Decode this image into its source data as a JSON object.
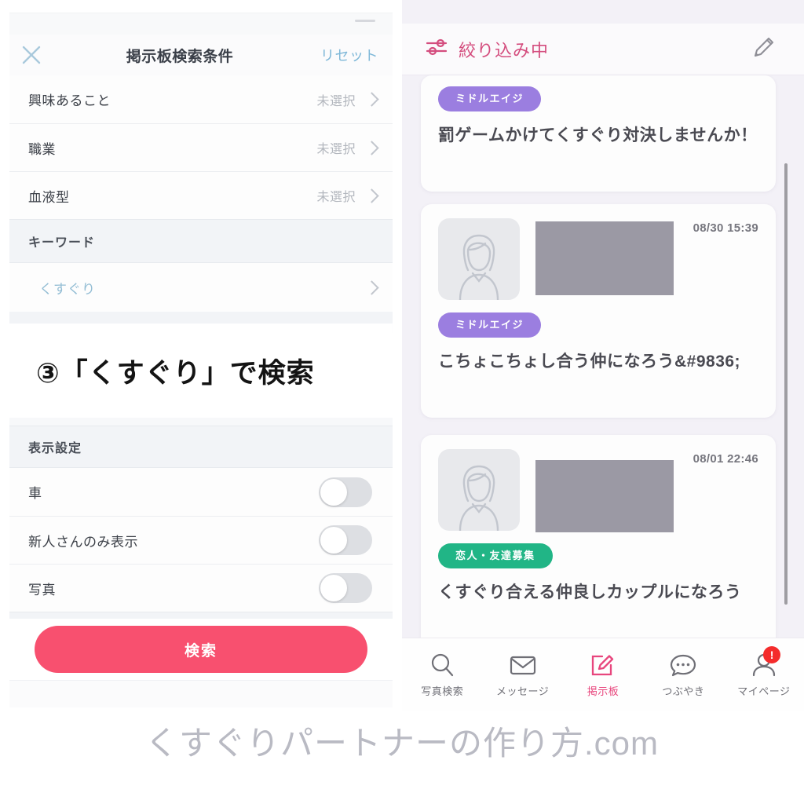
{
  "left_panel": {
    "header": {
      "close_icon": "close-x-icon",
      "title": "掲示板検索条件",
      "reset_label": "リセット"
    },
    "filter_rows": [
      {
        "label": "興味あること",
        "value": "未選択",
        "chevron": "chevron-right-icon"
      },
      {
        "label": "職業",
        "value": "未選択",
        "chevron": "chevron-right-icon"
      },
      {
        "label": "血液型",
        "value": "未選択",
        "chevron": "chevron-right-icon"
      }
    ],
    "keyword_section": {
      "section_label": "キーワード",
      "keyword_value": "くすぐり",
      "chevron": "chevron-right-icon"
    },
    "display_section": {
      "section_label": "表示設定",
      "toggles": [
        {
          "label": "車",
          "on": false
        },
        {
          "label": "新人さんのみ表示",
          "on": false
        },
        {
          "label": "写真",
          "on": false
        }
      ]
    },
    "search_button_label": "検索"
  },
  "caption": {
    "text": "③「くすぐり」で検索"
  },
  "right_panel": {
    "header": {
      "filter_icon": "sliders-filter-icon",
      "filter_label": "絞り込み中",
      "edit_icon": "pencil-edit-icon"
    },
    "cards": [
      {
        "clipped_top": true,
        "badge": {
          "label": "ミドルエイジ",
          "color": "#9b7ee0"
        },
        "text": "罰ゲームかけてくすぐり対決しませんか！",
        "time": "",
        "has_media": false
      },
      {
        "clipped_top": false,
        "badge": {
          "label": "ミドルエイジ",
          "color": "#9b7ee0"
        },
        "text": "こちょこちょし合う仲になろう&#9836;",
        "time": "08/30 15:39",
        "has_media": true,
        "avatar_icon": "person-placeholder-icon",
        "redaction": "redaction-bar"
      },
      {
        "clipped_top": false,
        "badge": {
          "label": "恋人・友達募集",
          "color": "#21b586"
        },
        "text": "くすぐり合える仲良しカップルになろう",
        "time": "08/01 22:46",
        "has_media": true,
        "avatar_icon": "person-placeholder-icon",
        "redaction": "redaction-bar"
      }
    ],
    "tabbar": [
      {
        "label": "写真検索",
        "icon": "search-icon",
        "active": false,
        "badge": ""
      },
      {
        "label": "メッセージ",
        "icon": "mail-envelope-icon",
        "active": false,
        "badge": ""
      },
      {
        "label": "掲示板",
        "icon": "compose-board-icon",
        "active": true,
        "badge": ""
      },
      {
        "label": "つぶやき",
        "icon": "chat-bubble-icon",
        "active": false,
        "badge": ""
      },
      {
        "label": "マイページ",
        "icon": "person-icon",
        "active": false,
        "badge": "!"
      }
    ]
  },
  "watermark": {
    "text": "くすぐりパートナーの作り方.com"
  },
  "colors": {
    "accent_pink": "#f8506f",
    "header_pink": "#d44d7e",
    "active_tab_pink": "#e8467d",
    "badge_purple": "#9b7ee0",
    "badge_green": "#21b586",
    "link_blue": "#7fb8d8",
    "keyword_blue": "#93bdd4",
    "redaction_grey": "#9b99a4",
    "panel_bg_lavender": "#f3f1f7"
  }
}
